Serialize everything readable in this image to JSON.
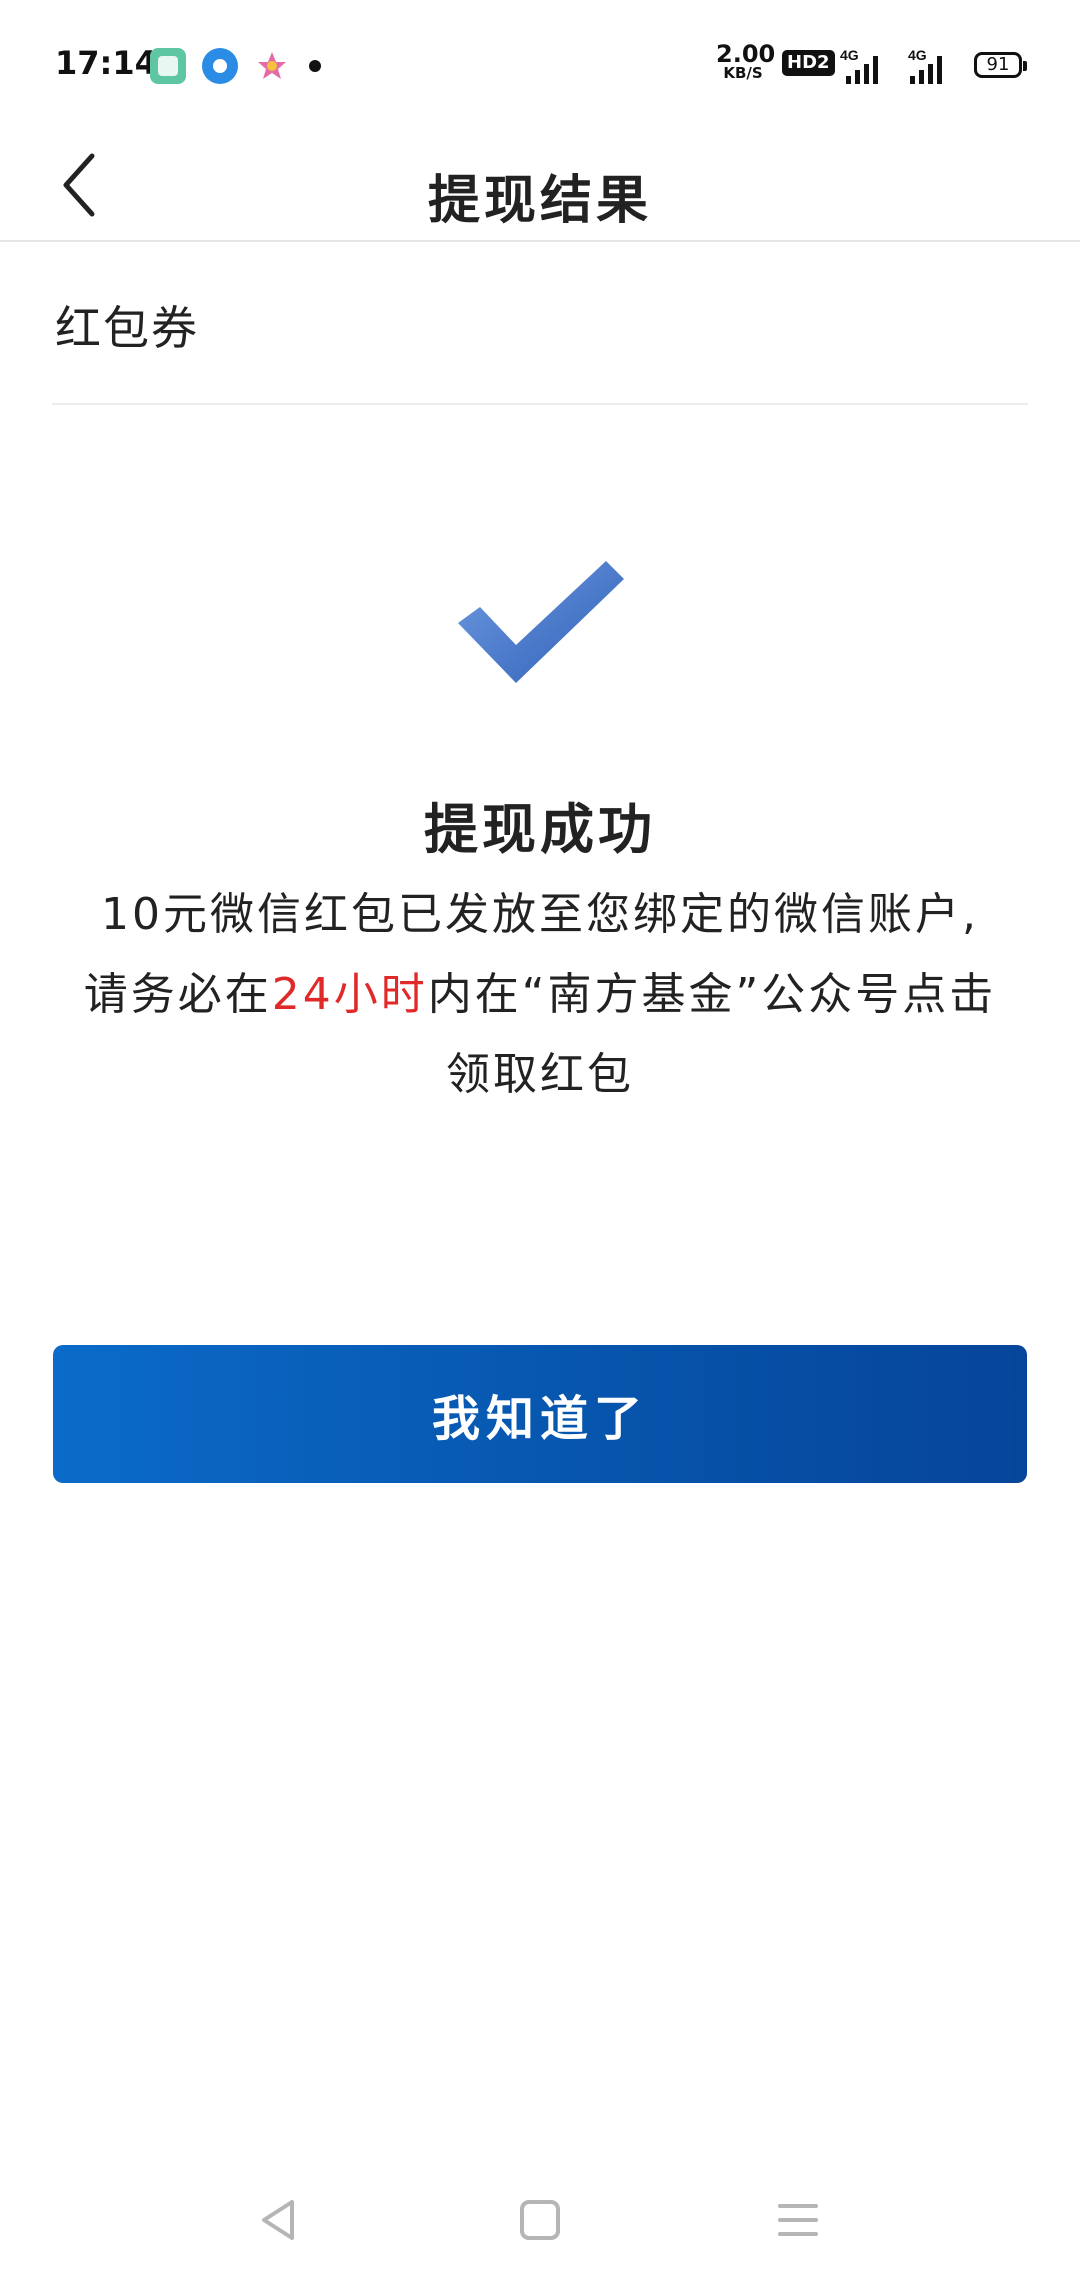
{
  "status_bar": {
    "time": "17:14",
    "net_speed_value": "2.00",
    "net_speed_unit": "KB/S",
    "hd_badge": "HD2",
    "signal1_label": "4G",
    "signal2_label": "4G",
    "battery": "91"
  },
  "header": {
    "title": "提现结果",
    "back_icon": "chevron-left-icon"
  },
  "section": {
    "label": "红包券"
  },
  "result": {
    "icon": "checkmark-icon",
    "accent_color": "#3d6fc4",
    "title": "提现成功",
    "message_line1": "10元微信红包已发放至您绑定的微信账户,",
    "message_prefix": "请务必在",
    "message_highlight": "24小时",
    "message_suffix": "内在“南方基金”公众号点击领取红包",
    "highlight_color": "#e02a2a"
  },
  "button": {
    "label": "我知道了",
    "color": "#0755ad"
  },
  "nav_bar": {
    "back_icon": "triangle-back-icon",
    "home_icon": "square-home-icon",
    "menu_icon": "menu-lines-icon"
  }
}
